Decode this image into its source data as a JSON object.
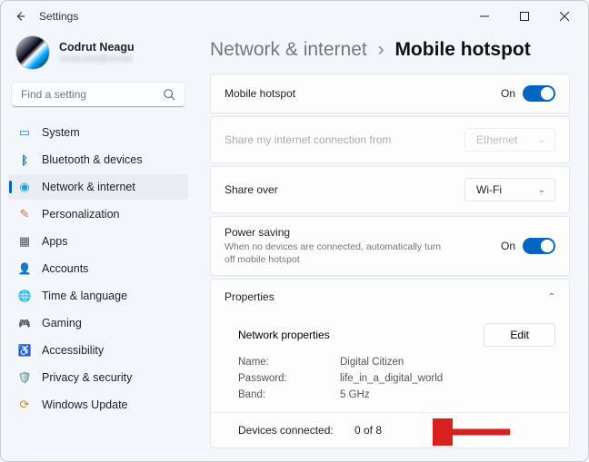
{
  "window": {
    "title": "Settings"
  },
  "user": {
    "name": "Codrut Neagu",
    "subtitle": "redacted@email"
  },
  "search": {
    "placeholder": "Find a setting"
  },
  "sidebar": {
    "items": [
      {
        "label": "System",
        "icon": "🖥️"
      },
      {
        "label": "Bluetooth & devices",
        "icon": "ᛒ"
      },
      {
        "label": "Network & internet",
        "icon": "◆"
      },
      {
        "label": "Personalization",
        "icon": "✎"
      },
      {
        "label": "Apps",
        "icon": "▦"
      },
      {
        "label": "Accounts",
        "icon": "👤"
      },
      {
        "label": "Time & language",
        "icon": "🌐"
      },
      {
        "label": "Gaming",
        "icon": "🎮"
      },
      {
        "label": "Accessibility",
        "icon": "♿"
      },
      {
        "label": "Privacy & security",
        "icon": "🛡️"
      },
      {
        "label": "Windows Update",
        "icon": "⟳"
      }
    ]
  },
  "breadcrumb": {
    "parent": "Network & internet",
    "sep": "›",
    "current": "Mobile hotspot"
  },
  "main": {
    "hotspot": {
      "label": "Mobile hotspot",
      "state": "On"
    },
    "shareFrom": {
      "label": "Share my internet connection from",
      "value": "Ethernet"
    },
    "shareOver": {
      "label": "Share over",
      "value": "Wi-Fi"
    },
    "powerSaving": {
      "label": "Power saving",
      "sub": "When no devices are connected, automatically turn off mobile hotspot",
      "state": "On"
    },
    "properties": {
      "title": "Properties",
      "networkProps": "Network properties",
      "editLabel": "Edit",
      "nameKey": "Name:",
      "nameVal": "Digital Citizen",
      "passKey": "Password:",
      "passVal": "life_in_a_digital_world",
      "bandKey": "Band:",
      "bandVal": "5 GHz",
      "devicesKey": "Devices connected:",
      "devicesVal": "0 of 8"
    }
  }
}
